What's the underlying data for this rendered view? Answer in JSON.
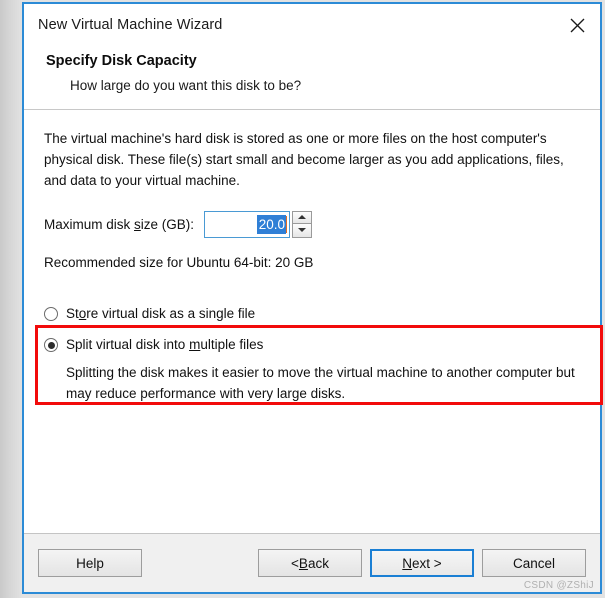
{
  "window": {
    "title": "New Virtual Machine Wizard",
    "close_icon": "close-icon"
  },
  "header": {
    "title": "Specify Disk Capacity",
    "subtitle": "How large do you want this disk to be?"
  },
  "body": {
    "description": "The virtual machine's hard disk is stored as one or more files on the host computer's physical disk. These file(s) start small and become larger as you add applications, files, and data to your virtual machine.",
    "disk_size": {
      "label_before": "Maximum disk ",
      "label_accel": "s",
      "label_after": "ize (GB):",
      "value": "20.0",
      "up_icon": "spinner-up-icon",
      "down_icon": "spinner-down-icon"
    },
    "recommended": "Recommended size for Ubuntu 64-bit: 20 GB",
    "options": [
      {
        "before": "St",
        "accel": "o",
        "after": "re virtual disk as a single file",
        "selected": false
      },
      {
        "before": "Split virtual disk into ",
        "accel": "m",
        "after": "ultiple files",
        "selected": true
      }
    ],
    "split_description": "Splitting the disk makes it easier to move the virtual machine to another computer but may reduce performance with very large disks."
  },
  "footer": {
    "help": "Help",
    "back_before": "< ",
    "back_accel": "B",
    "back_after": "ack",
    "next_accel": "N",
    "next_after": "ext >",
    "cancel": "Cancel"
  },
  "watermark": "CSDN @ZShiJ",
  "colors": {
    "window_border": "#2c8bd6",
    "accent": "#1a7fd4",
    "selection": "#2f7fd6",
    "annotation_red": "#f20b0b"
  }
}
